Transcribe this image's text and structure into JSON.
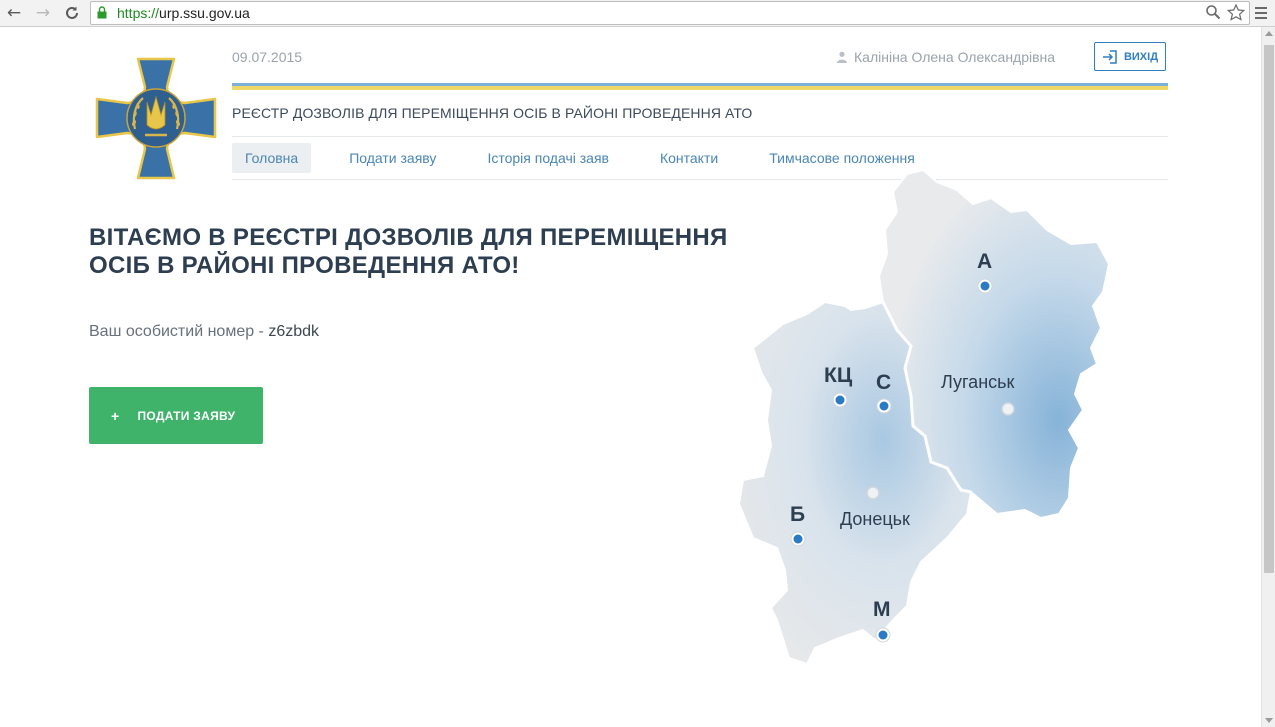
{
  "browser": {
    "url_prefix": "https://",
    "url_host": "urp.ssu.gov.ua"
  },
  "header": {
    "date": "09.07.2015",
    "user_name": "Калініна Олена Олександрівна",
    "logout_label": "ВИХІД",
    "site_title": "РЕЄСТР ДОЗВОЛІВ ДЛЯ ПЕРЕМІЩЕННЯ ОСІБ В РАЙОНІ ПРОВЕДЕННЯ АТО"
  },
  "nav": {
    "items": [
      {
        "label": "Головна",
        "active": true
      },
      {
        "label": "Подати заяву",
        "active": false
      },
      {
        "label": "Історія подачі заяв",
        "active": false
      },
      {
        "label": "Контакти",
        "active": false
      },
      {
        "label": "Тимчасове положення",
        "active": false
      }
    ]
  },
  "main": {
    "headline_line1": "ВІТАЄМО В РЕЄСТРІ ДОЗВОЛІВ ДЛЯ ПЕРЕМІЩЕННЯ",
    "headline_line2": "ОСІБ В РАЙОНІ ПРОВЕДЕННЯ АТО!",
    "personal_label": "Ваш особистий номер -",
    "personal_number": "z6zbdk",
    "apply_plus": "+",
    "apply_label": "ПОДАТИ ЗАЯВУ"
  },
  "map": {
    "checkpoints": [
      "А",
      "КЦ",
      "С",
      "Б",
      "М"
    ],
    "cities": [
      "Луганськ",
      "Донецьк"
    ]
  },
  "colors": {
    "accent_blue": "#2f7fc1",
    "apply_green": "#3fb36a",
    "flag_blue": "#7ab0d9",
    "flag_yellow": "#f0d867",
    "heading": "#2d3e50"
  }
}
